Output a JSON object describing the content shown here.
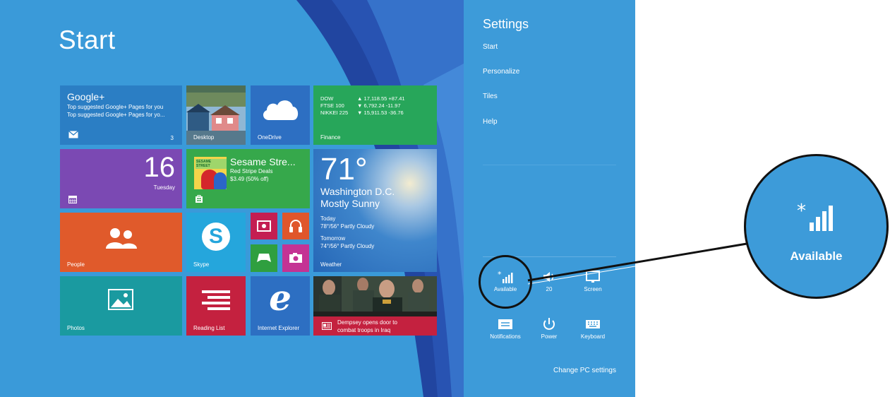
{
  "start": {
    "title": "Start"
  },
  "tiles": {
    "mail": {
      "title": "Google+",
      "line1": "Top suggested Google+ Pages for you",
      "line2": "Top suggested Google+ Pages for yo...",
      "count": "3"
    },
    "desktop": {
      "label": "Desktop"
    },
    "onedrive": {
      "label": "OneDrive"
    },
    "finance": {
      "label": "Finance",
      "rows": [
        {
          "name": "DOW",
          "arrow": "▲",
          "value": "17,118.55 +87.41"
        },
        {
          "name": "FTSE 100",
          "arrow": "▼",
          "value": "6,792.24 -11.97"
        },
        {
          "name": "NIKKEI 225",
          "arrow": "▼",
          "value": "15,911.53 -36.76"
        }
      ]
    },
    "calendar": {
      "day": "16",
      "weekday": "Tuesday"
    },
    "store": {
      "title": "Sesame Stre...",
      "sub1": "Red Stripe Deals",
      "sub2": "$3.49 (50% off)",
      "box": "SESAME STREET"
    },
    "weather": {
      "temp": "71°",
      "city": "Washington D.C.",
      "cond": "Mostly Sunny",
      "today_label": "Today",
      "today": "78°/56° Partly Cloudy",
      "tomorrow_label": "Tomorrow",
      "tomorrow": "74°/56° Partly Cloudy",
      "label": "Weather"
    },
    "people": {
      "label": "People"
    },
    "skype": {
      "label": "Skype"
    },
    "photos": {
      "label": "Photos"
    },
    "reading": {
      "label": "Reading List"
    },
    "ie": {
      "label": "Internet Explorer"
    },
    "news": {
      "line1": "Dempsey opens door to",
      "line2": "combat troops in Iraq"
    }
  },
  "charms": {
    "title": "Settings",
    "links": [
      "Start",
      "Personalize",
      "Tiles",
      "Help"
    ],
    "quick": [
      {
        "label": "Available",
        "icon": "network-icon"
      },
      {
        "label": "20",
        "icon": "volume-icon"
      },
      {
        "label": "Screen",
        "icon": "screen-icon"
      },
      {
        "label": "Notifications",
        "icon": "notifications-icon"
      },
      {
        "label": "Power",
        "icon": "power-icon"
      },
      {
        "label": "Keyboard",
        "icon": "keyboard-icon"
      }
    ],
    "change": "Change PC settings"
  },
  "callout": {
    "label": "Available"
  },
  "colors": {
    "background": "#3a9ad9",
    "mail": "#2b7ec4",
    "finance": "#27a65a",
    "calendar": "#7b49b3",
    "store": "#36a84b",
    "people": "#e05a2b",
    "skype": "#25a6dc",
    "photos": "#1a9aa0",
    "reading": "#c4213f",
    "ie": "#2d6fc2",
    "video": "#c41e52",
    "music": "#e0562b",
    "games": "#2f9f3f",
    "camera": "#c43394",
    "news": "#c4213f"
  }
}
